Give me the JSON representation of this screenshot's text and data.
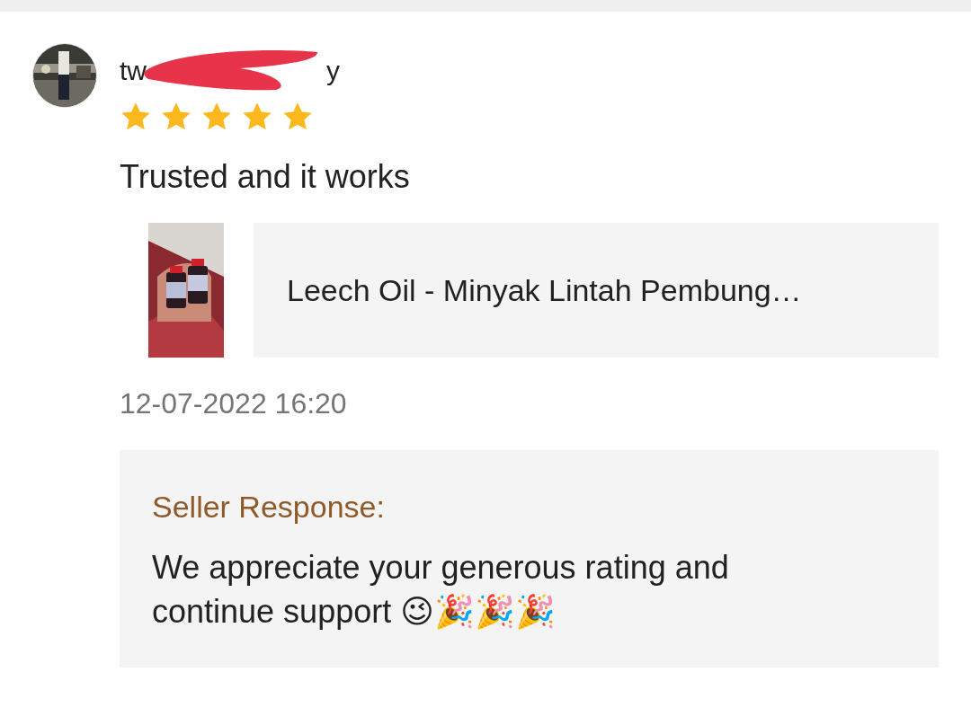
{
  "review": {
    "username_parts": [
      "tw",
      "y"
    ],
    "redacted": true,
    "stars": 5,
    "text": "Trusted and it works",
    "product": {
      "name": "Leech Oil - Minyak Lintah Pembung…"
    },
    "date": "12-07-2022 16:20",
    "seller_response": {
      "label": "Seller Response:",
      "text": "We appreciate your generous rating and continue support 😉🎉🎉🎉"
    }
  }
}
